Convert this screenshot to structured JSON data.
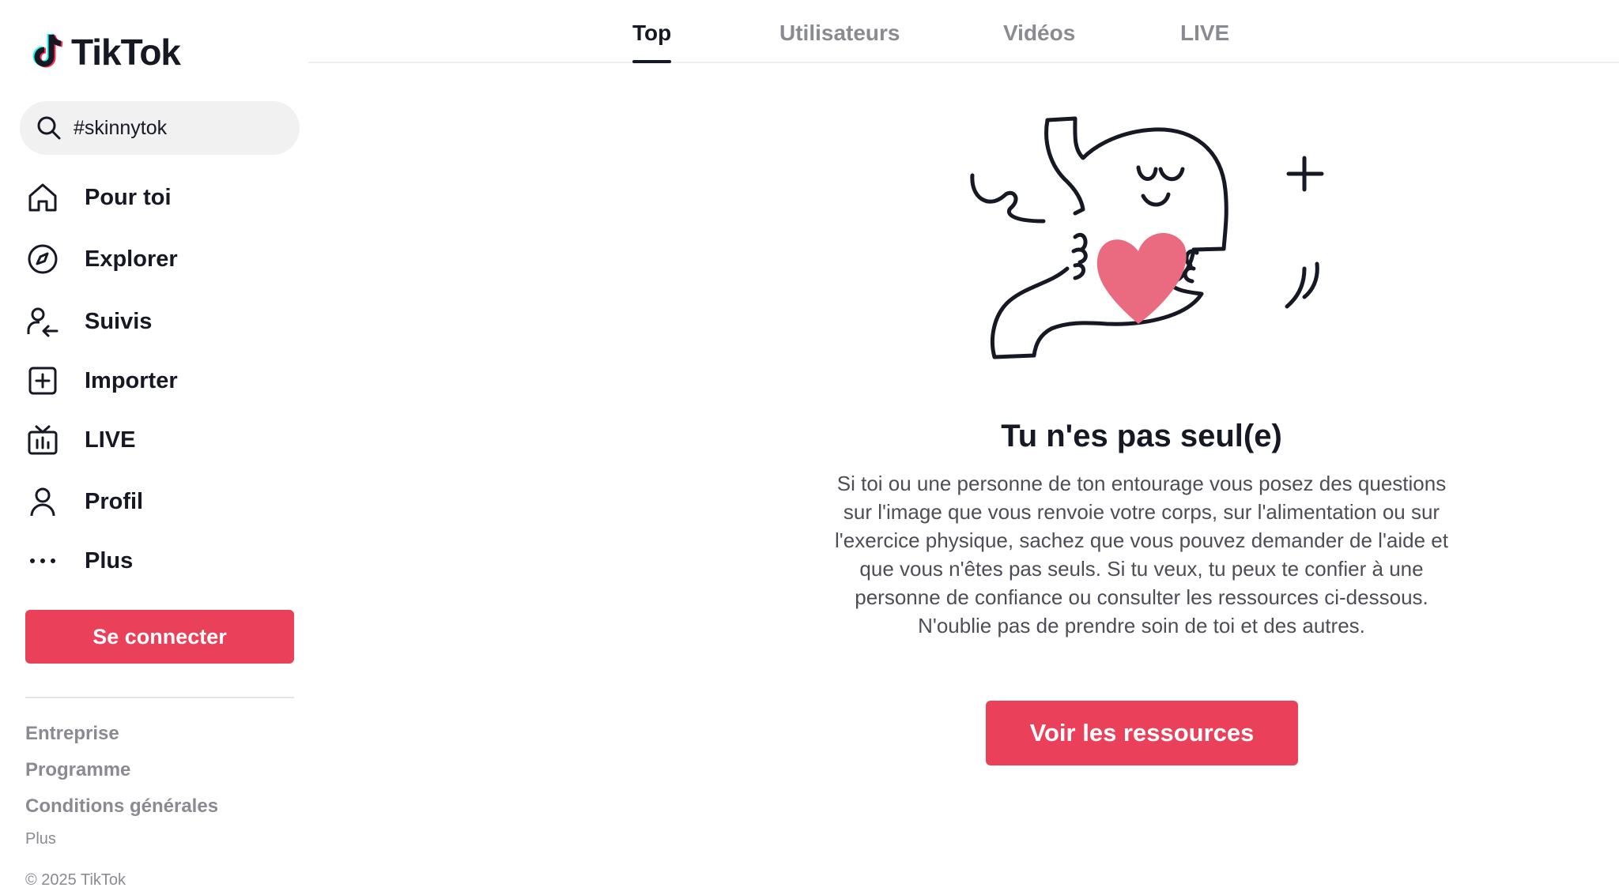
{
  "app": {
    "logo_text": "TikTok",
    "brand_color": "#ea405a"
  },
  "search": {
    "value": "#skinnytok",
    "icon": "search-icon"
  },
  "sidebar": {
    "items": [
      {
        "label": "Pour toi",
        "icon": "home-icon"
      },
      {
        "label": "Explorer",
        "icon": "compass-icon"
      },
      {
        "label": "Suivis",
        "icon": "following-icon"
      },
      {
        "label": "Importer",
        "icon": "upload-icon"
      },
      {
        "label": "LIVE",
        "icon": "live-tv-icon"
      },
      {
        "label": "Profil",
        "icon": "profile-icon"
      },
      {
        "label": "Plus",
        "icon": "more-dots-icon"
      }
    ],
    "login_label": "Se connecter",
    "footer": {
      "links": [
        "Entreprise",
        "Programme",
        "Conditions générales"
      ],
      "more": "Plus",
      "copyright": "© 2025 TikTok"
    }
  },
  "tabs": [
    {
      "label": "Top",
      "active": true
    },
    {
      "label": "Utilisateurs",
      "active": false
    },
    {
      "label": "Vidéos",
      "active": false
    },
    {
      "label": "LIVE",
      "active": false
    }
  ],
  "main": {
    "illustration": "stomach-heart-illustration",
    "title": "Tu n'es pas seul(e)",
    "body": "Si toi ou une personne de ton entourage vous posez des questions sur l'image que vous renvoie votre corps, sur l'alimentation ou sur l'exercice physique, sachez que vous pouvez demander de l'aide et que vous n'êtes pas seuls. Si tu veux, tu peux te confier à une personne de confiance ou consulter les ressources ci-dessous. N'oublie pas de prendre soin de toi et des autres.",
    "cta_label": "Voir les ressources"
  }
}
